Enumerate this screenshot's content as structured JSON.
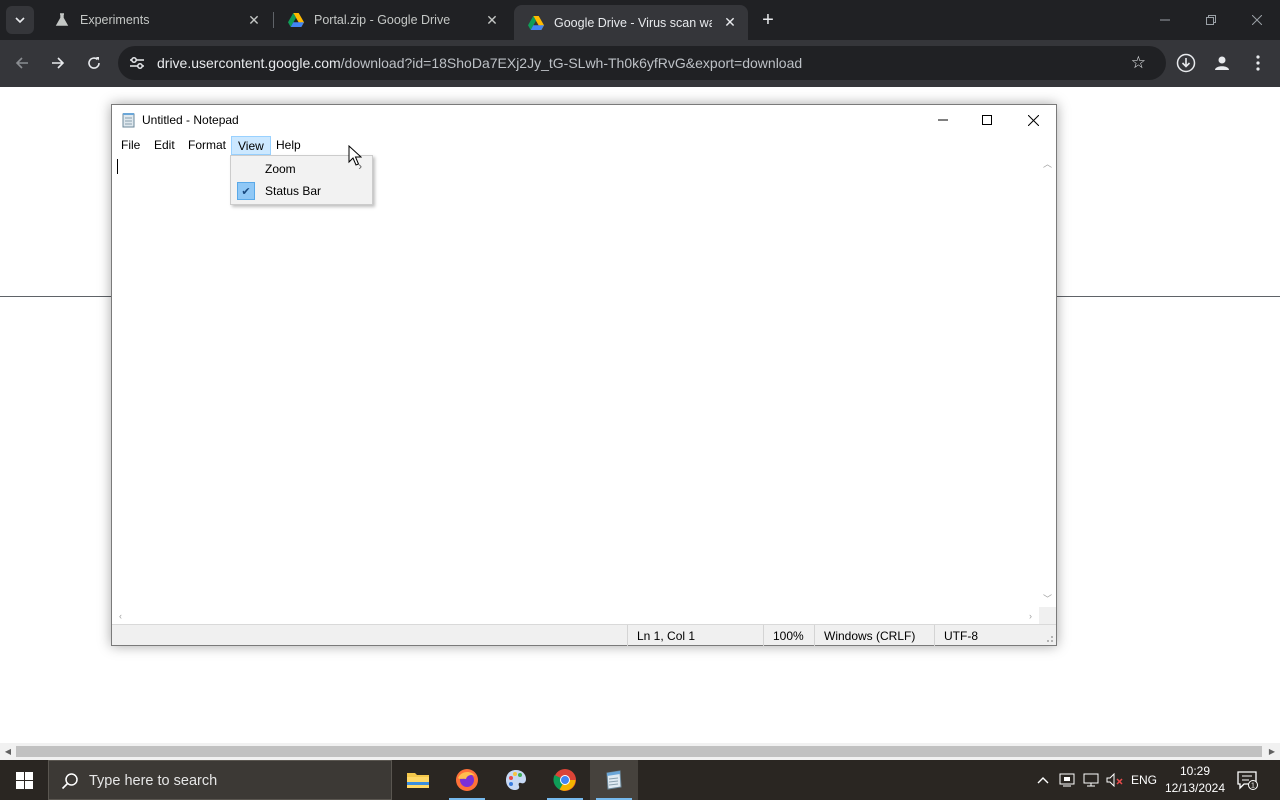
{
  "browser": {
    "tabs": [
      {
        "title": "Experiments",
        "favicon": "flask-icon",
        "active": false
      },
      {
        "title": "Portal.zip - Google Drive",
        "favicon": "google-drive-icon",
        "active": false
      },
      {
        "title": "Google Drive - Virus scan warn",
        "favicon": "google-drive-icon",
        "active": true
      }
    ],
    "url_domain": "drive.usercontent.google.com",
    "url_path": "/download?id=18ShoDa7EXj2Jy_tG-SLwh-Th0k6yfRvG&export=download"
  },
  "notepad": {
    "window_title": "Untitled - Notepad",
    "menu": [
      "File",
      "Edit",
      "Format",
      "View",
      "Help"
    ],
    "open_menu": "View",
    "view_menu_items": [
      {
        "label": "Zoom",
        "has_submenu": true,
        "checked": false
      },
      {
        "label": "Status Bar",
        "has_submenu": false,
        "checked": true
      }
    ],
    "content": "",
    "status": {
      "position": "Ln 1, Col 1",
      "zoom": "100%",
      "line_ending": "Windows (CRLF)",
      "encoding": "UTF-8"
    }
  },
  "taskbar": {
    "search_placeholder": "Type here to search",
    "apps": [
      "file-explorer-icon",
      "firefox-icon",
      "paint-icon",
      "chrome-icon",
      "notepad-icon"
    ],
    "active_app": "notepad-icon",
    "language": "ENG",
    "time": "10:29",
    "date": "12/13/2024",
    "notification_count": "1"
  }
}
